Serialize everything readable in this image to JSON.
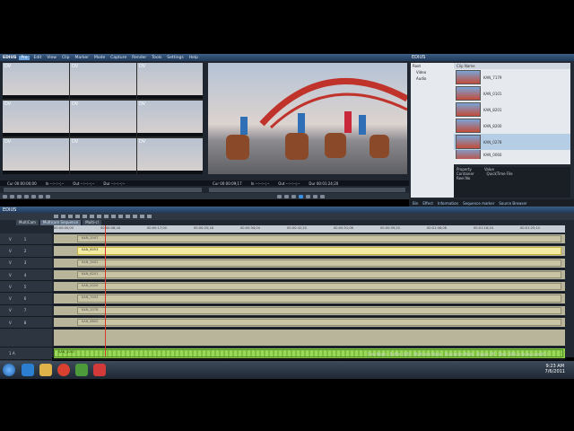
{
  "app": {
    "name": "EDIUS",
    "badge": "Pro",
    "menu": [
      "Edit",
      "View",
      "Clip",
      "Marker",
      "Mode",
      "Capture",
      "Render",
      "Tools",
      "Settings",
      "Help"
    ]
  },
  "player": {
    "labels": [
      "DV",
      "DV",
      "DV",
      "DV",
      "DV",
      "DV",
      "DV",
      "DV",
      "DV"
    ],
    "timecode": {
      "cur": "Cur 00:00:00;00",
      "in": "In --:--:--;--",
      "out": "Out --:--:--;--",
      "dur": "Dur --:--:--;--"
    }
  },
  "recorder": {
    "timecode": {
      "cur": "Cur 00:00:09;17",
      "in": "In --:--:--;--",
      "out": "Out --:--:--;--",
      "dur": "Dur 00:01:24;20"
    }
  },
  "bin": {
    "title": "EDIUS",
    "folders": [
      "Root",
      "Video",
      "Audio"
    ],
    "clip_header": "Clip Name",
    "clips": [
      "KAN_7179",
      "KAN_0101",
      "KAN_8201",
      "KAN_8200",
      "KAN_0278",
      "KAN_0060"
    ],
    "properties": [
      {
        "key": "Property",
        "val": "Value"
      },
      {
        "key": "Container",
        "val": "QuickTime File"
      },
      {
        "key": "Reel No",
        "val": ""
      }
    ],
    "tabs": [
      "Bin",
      "Effect",
      "Information",
      "Sequence marker",
      "Source Browser"
    ]
  },
  "timeline": {
    "title": "EDIUS",
    "sequence_tabs": [
      "MultiCam",
      "Multicam Sequence",
      "Multi-cl"
    ],
    "ruler": [
      "00:00:00;00",
      "00:00:08;16",
      "00:00:17;00",
      "00:00:25;16",
      "00:00:34;04",
      "00:00:42;20",
      "00:00:51;06",
      "00:00:59;20",
      "00:01:08;08",
      "00:01:16;24",
      "00:01:25;10"
    ],
    "tracks": [
      {
        "name": "V",
        "num": "1",
        "clip": "KAN_2047"
      },
      {
        "name": "V",
        "num": "2",
        "clip": "KAN_6053"
      },
      {
        "name": "V",
        "num": "3",
        "clip": "KAN_3402"
      },
      {
        "name": "V",
        "num": "4",
        "clip": "KAN_6201"
      },
      {
        "name": "V",
        "num": "5",
        "clip": "KAN_5020"
      },
      {
        "name": "V",
        "num": "6",
        "clip": "KAN_7003"
      },
      {
        "name": "V",
        "num": "7",
        "clip": "KAN_2078"
      },
      {
        "name": "V",
        "num": "8",
        "clip": "KAN_6800"
      },
      {
        "name": "1 A",
        "num": "",
        "clip": "KAN_2047"
      },
      {
        "name": "2 A",
        "num": "",
        "clip": "KAN_2047"
      }
    ],
    "status": [
      "Free Mode",
      "Buffer (4/5)",
      "Multicam Mode",
      "Overwrite Mode",
      "Ripple Off",
      "Disk: 38% is being used(C:)"
    ]
  },
  "taskbar": {
    "time": "9:23 AM",
    "date": "7/6/2011"
  }
}
